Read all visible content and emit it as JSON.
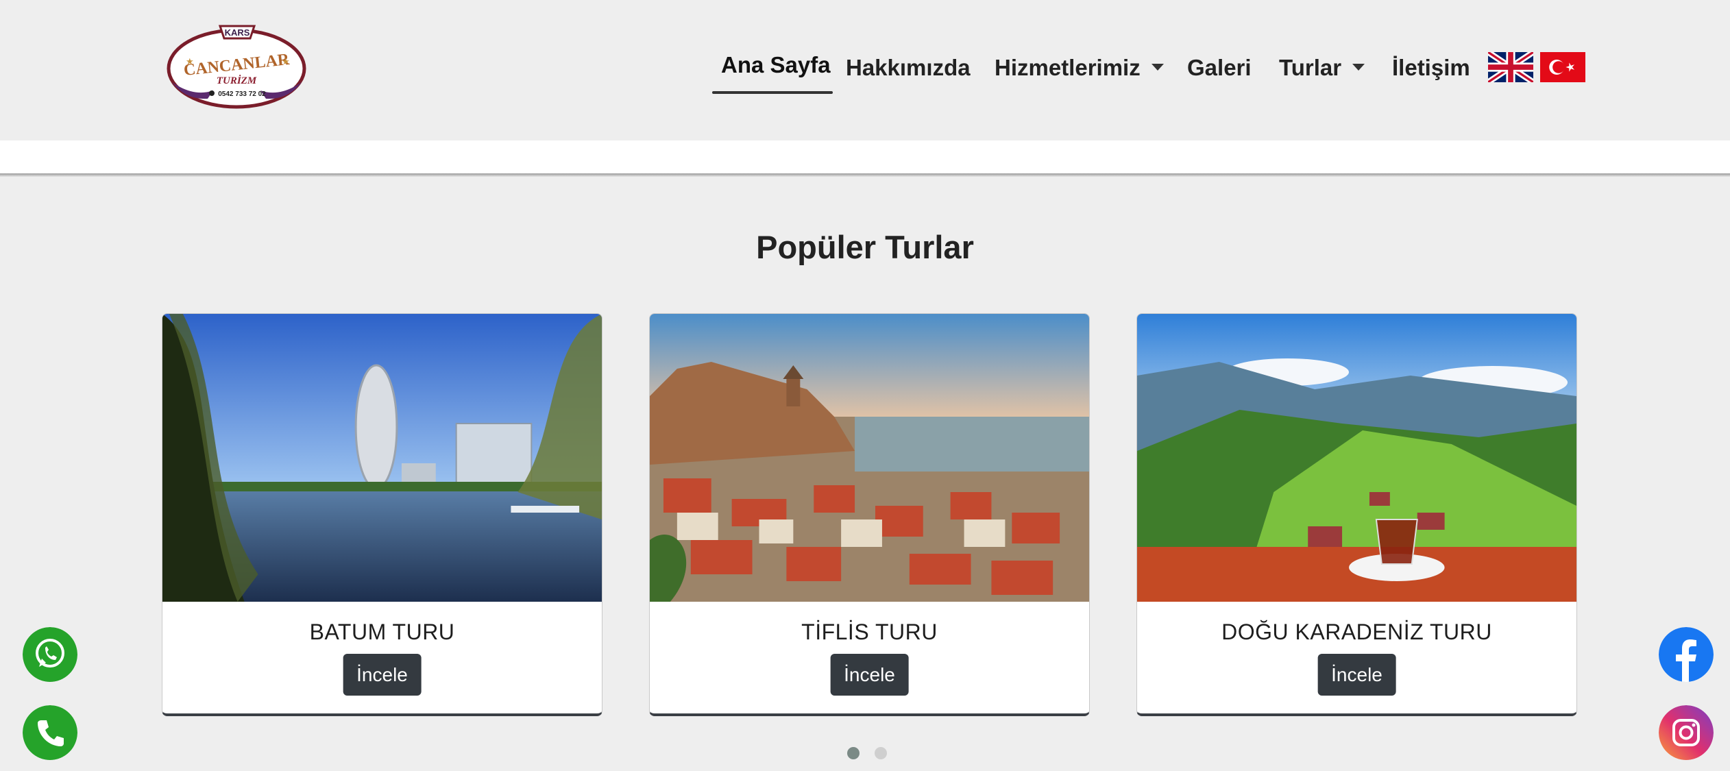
{
  "logo": {
    "top_text": "KARS",
    "name": "CANCANLAR",
    "sub": "TURİZM",
    "phone": "0542 733 72 02"
  },
  "nav": {
    "items": [
      {
        "label": "Ana Sayfa",
        "active": true
      },
      {
        "label": "Hakkımızda"
      },
      {
        "label": "Hizmetlerimiz",
        "dropdown": true
      },
      {
        "label": "Galeri"
      },
      {
        "label": "Turlar",
        "dropdown": true
      },
      {
        "label": "İletişim"
      }
    ],
    "flags": [
      "uk-flag",
      "turkey-flag"
    ]
  },
  "section": {
    "title": "Popüler Turlar"
  },
  "cards": [
    {
      "title": "BATUM TURU",
      "button": "İncele",
      "image": "batumi-lake-skyline"
    },
    {
      "title": "TİFLİS TURU",
      "button": "İncele",
      "image": "tbilisi-old-town"
    },
    {
      "title": "DOĞU KARADENİZ TURU",
      "button": "İncele",
      "image": "black-sea-plateau-tea"
    }
  ],
  "carousel": {
    "pages": 2,
    "active": 1
  },
  "floating": {
    "left": [
      "whatsapp-icon",
      "phone-icon"
    ],
    "right": [
      "facebook-icon",
      "instagram-icon"
    ]
  },
  "colors": {
    "background": "#eeeeee",
    "button": "#343a40",
    "whatsapp": "#25a32a",
    "facebook": "#1877f2",
    "dot_active": "#7b8a86",
    "dot_inactive": "#cfcfcf"
  }
}
